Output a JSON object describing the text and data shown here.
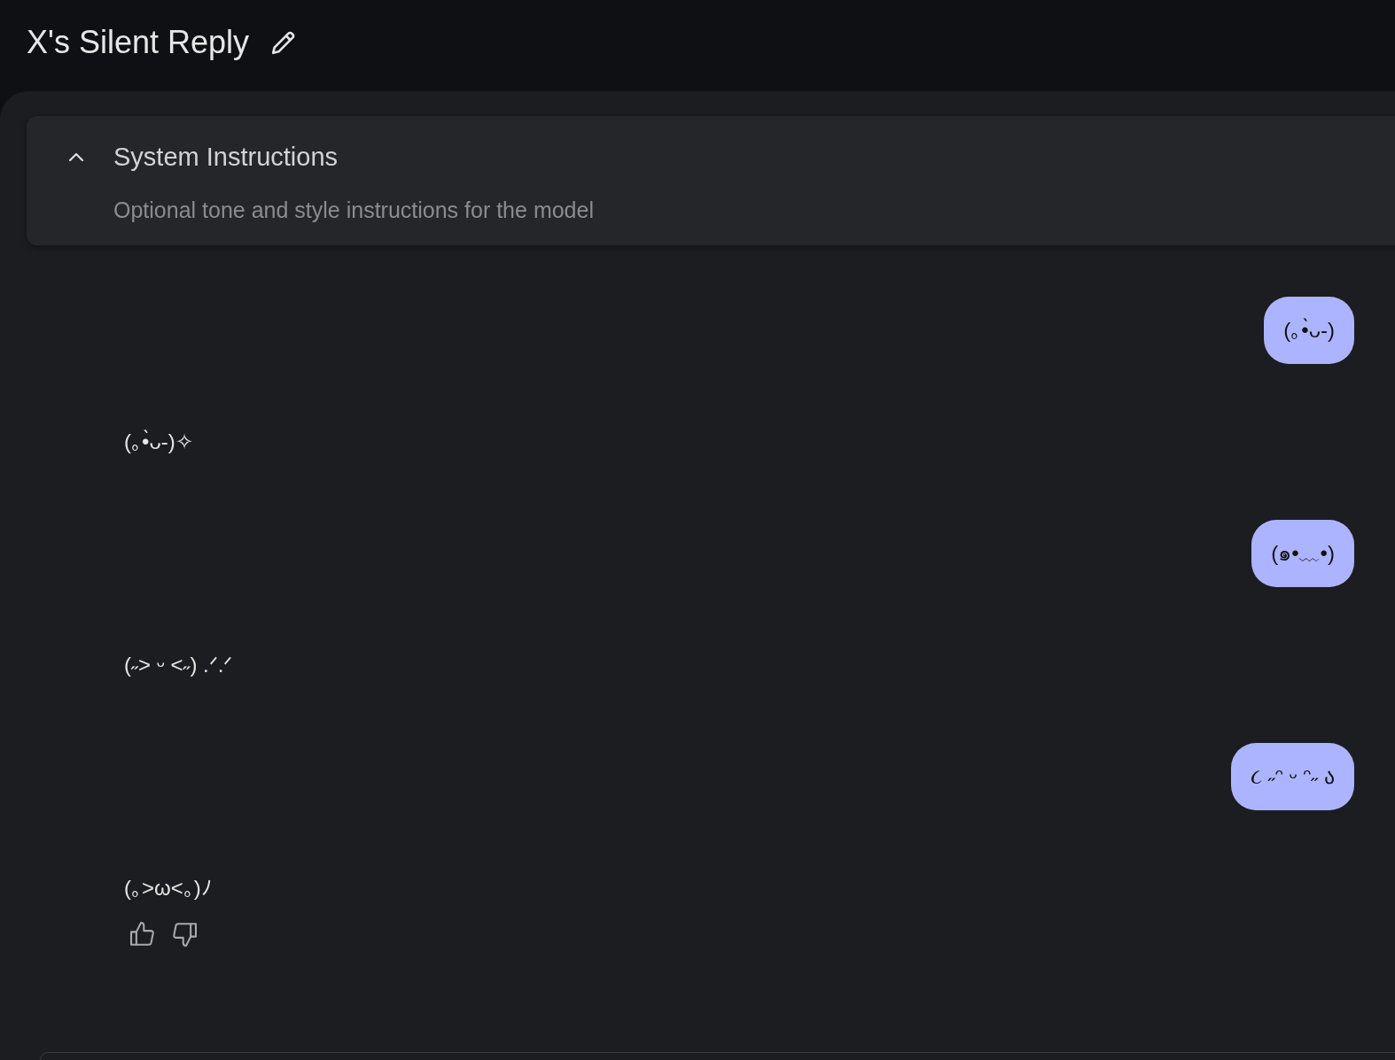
{
  "header": {
    "title": "X's Silent Reply"
  },
  "system_instructions": {
    "title": "System Instructions",
    "expanded": true,
    "placeholder": "Optional tone and style instructions for the model"
  },
  "messages": [
    {
      "kind": "user",
      "text": "(｡•̀ᴗ-)"
    },
    {
      "kind": "model",
      "text": "(｡•̀ᴗ-)✧"
    },
    {
      "kind": "user",
      "text": "(๑•﹏•)"
    },
    {
      "kind": "model",
      "text": "(˶˃ ᵕ ˂˶) .ᐟ.ᐟ"
    },
    {
      "kind": "user",
      "text": "૮ ˶ᵔ ᵕ ᵔ˶ ა"
    },
    {
      "kind": "model",
      "text": "(｡>ω<｡)ﾉ"
    }
  ]
}
